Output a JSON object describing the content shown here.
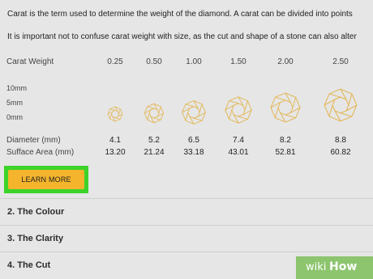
{
  "intro": {
    "line1": "Carat is the term used to determine the weight of the diamond. A carat can be divided into points",
    "line2": "It is important not to confuse carat weight with size, as the cut and shape of a stone can also alter"
  },
  "table": {
    "carat_label": "Carat Weight",
    "carats": [
      "0.25",
      "0.50",
      "1.00",
      "1.50",
      "2.00",
      "2.50"
    ],
    "scale": [
      "10mm",
      "5mm",
      "0mm"
    ],
    "diameter_label": "Diameter (mm)",
    "diameters": [
      "4.1",
      "5.2",
      "6.5",
      "7.4",
      "8.2",
      "8.8"
    ],
    "surface_label": "Sufface Area (mm)",
    "surfaces": [
      "13.20",
      "21.24",
      "33.18",
      "43.01",
      "52.81",
      "60.82"
    ],
    "gem_color": "#e3b85a"
  },
  "button": {
    "label": "LEARN MORE"
  },
  "sections": [
    {
      "label": "2. The Colour"
    },
    {
      "label": "3. The Clarity"
    },
    {
      "label": "4. The Cut"
    }
  ],
  "watermark": {
    "wiki": "wiki",
    "how": "How"
  }
}
